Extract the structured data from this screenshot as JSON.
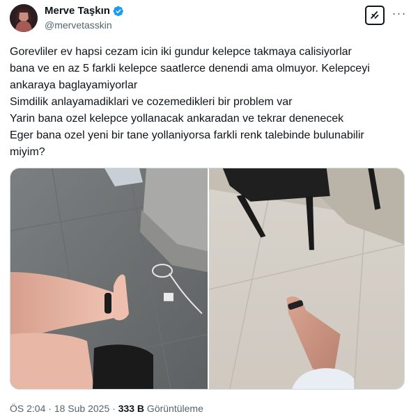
{
  "author": {
    "display_name": "Merve Taşkın",
    "handle": "@mervetasskin",
    "verified": true,
    "verified_color": "#1d9bf0"
  },
  "actions": {
    "grok_icon": "grok-icon",
    "more_icon": "more-horizontal-icon",
    "more_label": "···"
  },
  "tweet": {
    "lines": [
      "Gorevliler ev hapsi cezam icin iki gundur kelepce takmaya calisiyorlar",
      "bana ve en az 5 farkli kelepce saatlerce denendi ama olmuyor. Kelepceyi",
      "ankaraya baglayamiyorlar",
      "Simdilik anlayamadiklari ve cozemedikleri bir problem var",
      "Yarin bana ozel kelepce yollanacak ankaradan ve tekrar denenecek",
      "Eger bana ozel yeni bir tane yollaniyorsa farkli renk talebinde bulunabilir",
      "miyim?"
    ]
  },
  "media": {
    "photos": [
      "photo-1",
      "photo-2"
    ]
  },
  "meta": {
    "time": "ÖS 2:04",
    "sep1": " · ",
    "date": "18 Sub 2025",
    "sep2": " · ",
    "views": "333 B",
    "views_label": " Görüntüleme"
  }
}
